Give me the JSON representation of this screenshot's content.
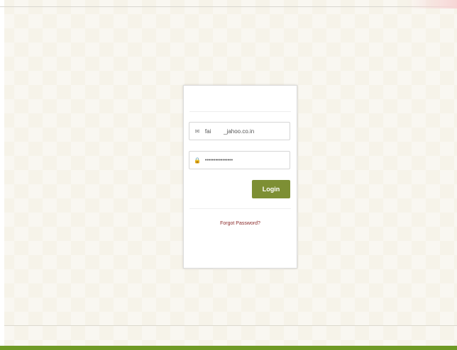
{
  "login": {
    "email_value": "fai        _jahoo.co.in",
    "password_value": "••••••••••••••••",
    "login_label": "Login",
    "forgot_label": "Forgot Password?"
  },
  "icons": {
    "email": "envelope-icon",
    "password": "lock-icon"
  },
  "colors": {
    "login_button": "#7d8f34",
    "bottom_bar": "#6f9a25",
    "forgot_link": "#8a2a2a",
    "background": "#f6f3e9"
  }
}
